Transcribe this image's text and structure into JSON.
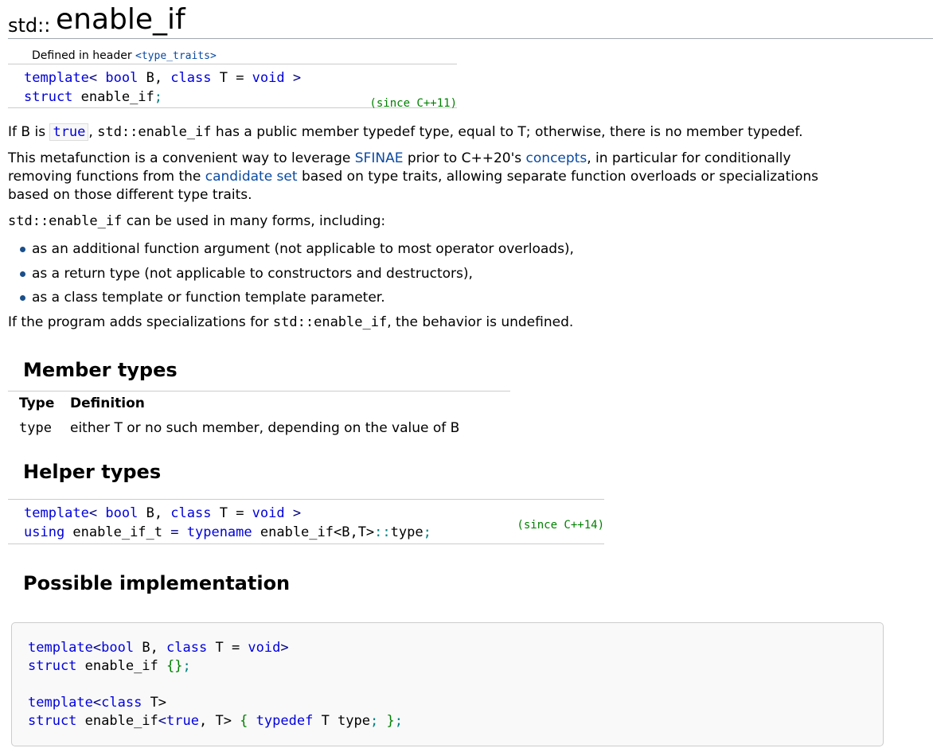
{
  "title": {
    "ns": "std::",
    "name": "enable_if"
  },
  "declaration": {
    "header_prefix": "Defined in header ",
    "header_link": "<type_traits>",
    "line1": {
      "kw_template": "template",
      "lt": "<",
      "kw_bool": "bool",
      "b": " B, ",
      "kw_class": "class",
      "t": " T = ",
      "kw_void": "void",
      "gt": " >"
    },
    "line2": {
      "kw_struct": "struct",
      "name": " enable_if",
      "semi": ";"
    },
    "since": "(since C++11)"
  },
  "intro": {
    "p1_a": "If B is ",
    "p1_true": "true",
    "p1_b": ", ",
    "p1_code": "std::enable_if",
    "p1_c": " has a public member typedef ",
    "p1_code2": "type",
    "p1_d": ", equal to T; otherwise, there is no member typedef.",
    "p2_a": "This metafunction is a convenient way to leverage ",
    "p2_link1": "SFINAE",
    "p2_b": " prior to C++20's ",
    "p2_link2": "concepts",
    "p2_c": ", in particular for conditionally",
    "p2_d": "removing functions from the ",
    "p2_link3": "candidate set",
    "p2_e": " based on type traits, allowing separate function overloads or specializations",
    "p2_f": "based on those different type traits.",
    "p3_code": "std::enable_if",
    "p3_text": " can be used in many forms, including:"
  },
  "forms": [
    "as an additional function argument (not applicable to most operator overloads),",
    "as a return type (not applicable to constructors and destructors),",
    "as a class template or function template parameter."
  ],
  "undefined": {
    "a": "If the program adds specializations for ",
    "code": "std::enable_if",
    "b": ", the behavior is undefined."
  },
  "member_types": {
    "heading": "Member types",
    "headers": [
      "Type",
      "Definition"
    ],
    "rows": [
      {
        "type": "type",
        "definition": "either T or no such member, depending on the value of B"
      }
    ]
  },
  "helper_types": {
    "heading": "Helper types",
    "line1": {
      "kw_template": "template",
      "lt": "<",
      "kw_bool": "bool",
      "b": " B, ",
      "kw_class": "class",
      "t": " T = ",
      "kw_void": "void",
      "gt": " >"
    },
    "line2": {
      "kw_using": "using",
      "a": " enable_if_t ",
      "eq": "=",
      "sp": " ",
      "kw_typename": "typename",
      "b": " enable_if<B,T>",
      "scope": "::",
      "c": "type",
      "semi": ";"
    },
    "since": "(since C++14)"
  },
  "implementation": {
    "heading": "Possible implementation",
    "l1": {
      "kw_template": "template",
      "lt": "<",
      "kw_bool": "bool",
      "b": " B, ",
      "kw_class": "class",
      "t": " T = ",
      "kw_void": "void",
      "gt": ">"
    },
    "l2": {
      "kw_struct": "struct",
      "a": " enable_if ",
      "braces": "{}",
      "semi": ";"
    },
    "l4": {
      "kw_template": "template",
      "lt": "<",
      "kw_class": "class",
      "a": " T>"
    },
    "l5": {
      "kw_struct": "struct",
      "a": " enable_if",
      "lt": "<",
      "kw_true": "true",
      "b": ", T> ",
      "lb": "{",
      "sp": " ",
      "kw_typedef": "typedef",
      "c": " T type",
      "semi": ";",
      "sp2": " ",
      "rb": "}",
      "semi2": ";"
    }
  }
}
